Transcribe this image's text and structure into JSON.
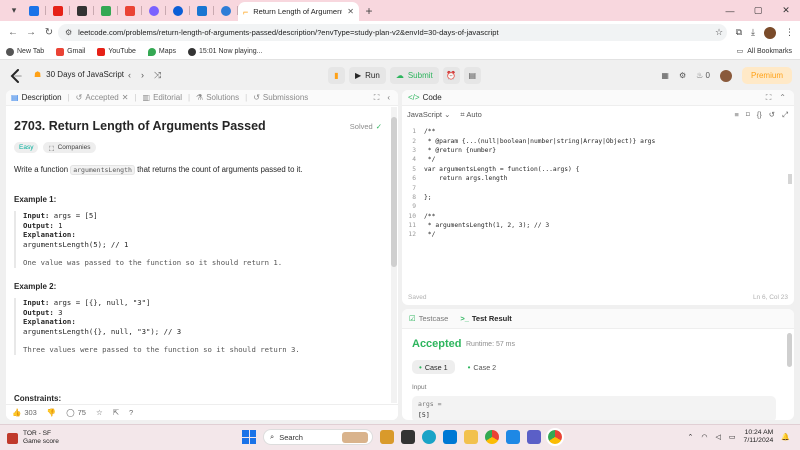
{
  "browser": {
    "active_tab_title": "Return Length of Arguments Pa",
    "url": "leetcode.com/problems/return-length-of-arguments-passed/description/?envType=study-plan-v2&envId=30-days-of-javascript",
    "bookmarks": [
      "New Tab",
      "Gmail",
      "YouTube",
      "Maps",
      "15:01 Now playing..."
    ],
    "all_bookmarks": "All Bookmarks",
    "tab_colors": [
      "#1a73e8",
      "#e62117",
      "#333333",
      "#34a853",
      "#ea4335",
      "#7b61ff",
      "#0b5ed7",
      "#1976d2",
      "#2e7dd7"
    ]
  },
  "lc_header": {
    "study_plan": "30 Days of JavaScript",
    "run_label": "Run",
    "submit_label": "Submit",
    "streak": "0",
    "premium_label": "Premium"
  },
  "left_tabs": {
    "description": "Description",
    "accepted": "Accepted",
    "editorial": "Editorial",
    "solutions": "Solutions",
    "submissions": "Submissions"
  },
  "problem": {
    "title": "2703. Return Length of Arguments Passed",
    "solved": "Solved",
    "difficulty": "Easy",
    "companies": "Companies",
    "desc_before": "Write a function ",
    "desc_code": "argumentsLength",
    "desc_after": " that returns the count of arguments passed to it.",
    "examples": [
      {
        "heading": "Example 1:",
        "input_label": "Input:",
        "input": " args = [5]",
        "output_label": "Output:",
        "output": " 1",
        "explanation_label": "Explanation:",
        "code": "argumentsLength(5); // 1",
        "note": "One value was passed to the function so it should return 1."
      },
      {
        "heading": "Example 2:",
        "input_label": "Input:",
        "input": " args = [{}, null, \"3\"]",
        "output_label": "Output:",
        "output": " 3",
        "explanation_label": "Explanation:",
        "code": "argumentsLength({}, null, \"3\"); // 3",
        "note": "Three values were passed to the function so it should return 3."
      }
    ],
    "constraints": "Constraints:",
    "likes": "303",
    "comments": "75"
  },
  "editor": {
    "panel_title": "Code",
    "language": "JavaScript",
    "mode": "Auto",
    "lines": [
      "/**",
      " * @param {...(null|boolean|number|string|Array|Object)} args",
      " * @return {number}",
      " */",
      "var argumentsLength = function(...args) {",
      "    return args.length",
      "",
      "};",
      "",
      "/**",
      " * argumentsLength(1, 2, 3); // 3",
      " */"
    ],
    "line_numbers": [
      "1",
      "2",
      "3",
      "4",
      "5",
      "6",
      "7",
      "8",
      "9",
      "10",
      "11",
      "12"
    ],
    "status": "Saved",
    "cursor": "Ln 6, Col 23"
  },
  "tests": {
    "testcase_tab": "Testcase",
    "result_tab": "Test Result",
    "verdict": "Accepted",
    "runtime": "Runtime: 57 ms",
    "case1": "Case 1",
    "case2": "Case 2",
    "input_label": "Input",
    "arg_label": "args =",
    "arg_value": "[5]"
  },
  "taskbar": {
    "weather_line1": "TOR - SF",
    "weather_line2": "Game score",
    "search": "Search",
    "time": "10:24 AM",
    "date": "7/11/2024"
  }
}
